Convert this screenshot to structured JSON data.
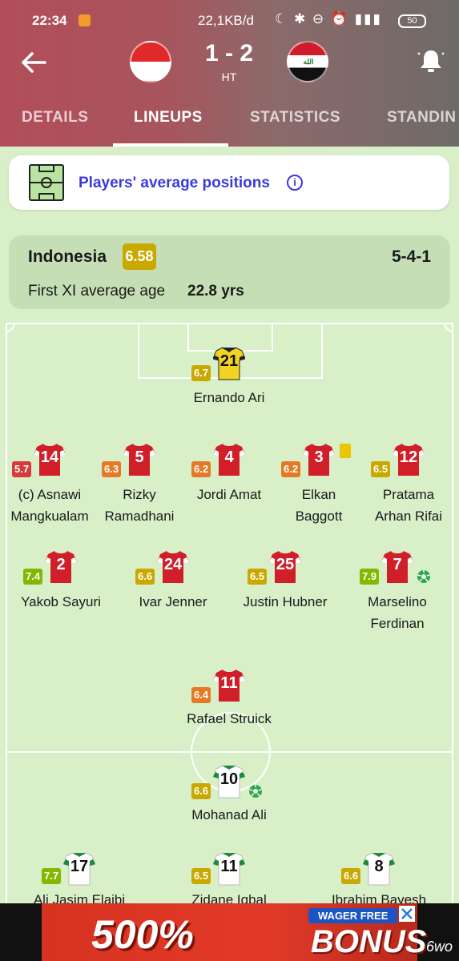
{
  "status_bar": {
    "time": "22:34",
    "network_speed": "22,1KB/d",
    "signal": "4G",
    "battery": "50"
  },
  "match": {
    "score": "1 - 2",
    "status": "HT",
    "home_flag": "indonesia-flag",
    "away_flag": "iraq-flag"
  },
  "tabs": [
    {
      "label": "DETAILS"
    },
    {
      "label": "LINEUPS"
    },
    {
      "label": "STATISTICS"
    },
    {
      "label": "STANDIN"
    }
  ],
  "avg_positions": {
    "label": "Players' average positions",
    "info": "i"
  },
  "team": {
    "name": "Indonesia",
    "rating": "6.58",
    "formation": "5-4-1",
    "avg_age_label": "First XI average age",
    "avg_age_value": "22.8 yrs"
  },
  "colors": {
    "home_shirt": "#d11f2a",
    "gk_shirt": "#f2d324",
    "away_shirt": "#ffffff",
    "away_trim": "#1e8a3a",
    "pitch": "#d8efc8",
    "accent": "#3a3bd8"
  },
  "players": {
    "gk": {
      "number": "21",
      "rating": "6.7",
      "name": "Ernando Ari"
    },
    "d1": {
      "number": "14",
      "rating": "5.7",
      "name1": "(c) Asnawi",
      "name2": "Mangkualam"
    },
    "d2": {
      "number": "5",
      "rating": "6.3",
      "name1": "Rizky",
      "name2": "Ramadhani"
    },
    "d3": {
      "number": "4",
      "rating": "6.2",
      "name1": "Jordi Amat"
    },
    "d4": {
      "number": "3",
      "rating": "6.2",
      "name1": "Elkan",
      "name2": "Baggott"
    },
    "d5": {
      "number": "12",
      "rating": "6.5",
      "name1": "Pratama",
      "name2": "Arhan Rifai"
    },
    "m1": {
      "number": "2",
      "rating": "7.4",
      "name1": "Yakob Sayuri"
    },
    "m2": {
      "number": "24",
      "rating": "6.6",
      "name1": "Ivar Jenner"
    },
    "m3": {
      "number": "25",
      "rating": "6.5",
      "name1": "Justin Hubner"
    },
    "m4": {
      "number": "7",
      "rating": "7.9",
      "name1": "Marselino",
      "name2": "Ferdinan"
    },
    "f1": {
      "number": "11",
      "rating": "6.4",
      "name1": "Rafael Struick"
    },
    "a1": {
      "number": "10",
      "rating": "6.6",
      "name1": "Mohanad Ali"
    },
    "a2": {
      "number": "17",
      "rating": "7.7",
      "name1": "Ali Jasim Elaibi"
    },
    "a3": {
      "number": "11",
      "rating": "6.5",
      "name1": "Zidane Iqbal"
    },
    "a4": {
      "number": "8",
      "rating": "6.6",
      "name1": "Ibrahim Bayesh"
    }
  },
  "ad": {
    "percent": "500%",
    "wager": "WAGER FREE",
    "bonus": "BONUS",
    "brand": "6wo"
  }
}
